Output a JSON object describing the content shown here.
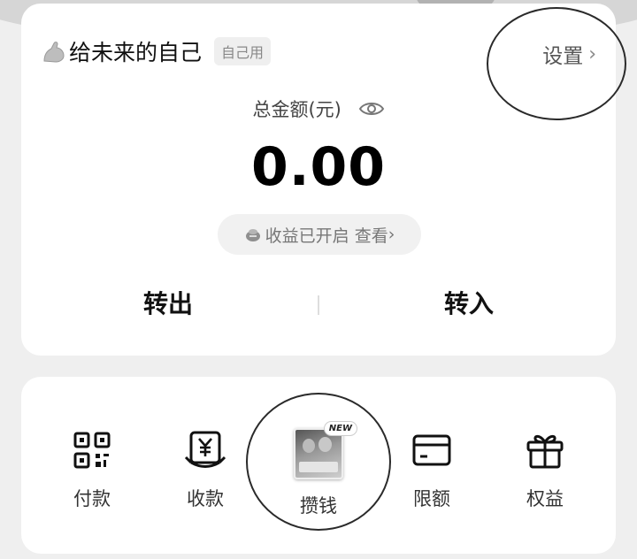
{
  "account": {
    "title": "给未来的自己",
    "tag": "自己用",
    "settings_label": "设置",
    "chevron": "›"
  },
  "balance": {
    "label": "总金额(元)",
    "amount": "0.00",
    "earning_status": "收益已开启",
    "earning_link": "查看",
    "chevron": "›"
  },
  "actions": {
    "transfer_out": "转出",
    "transfer_in": "转入"
  },
  "grid": {
    "items": [
      {
        "label": "付款",
        "icon": "qr-code-icon"
      },
      {
        "label": "收款",
        "icon": "yuan-receipt-icon"
      },
      {
        "label": "攒钱",
        "icon": "save-money-banner",
        "badge": "NEW"
      },
      {
        "label": "限额",
        "icon": "card-limit-icon"
      },
      {
        "label": "权益",
        "icon": "gift-icon"
      }
    ]
  },
  "colors": {
    "background": "#efefef",
    "card": "#ffffff",
    "annotation_ring": "#2a2a2a"
  }
}
